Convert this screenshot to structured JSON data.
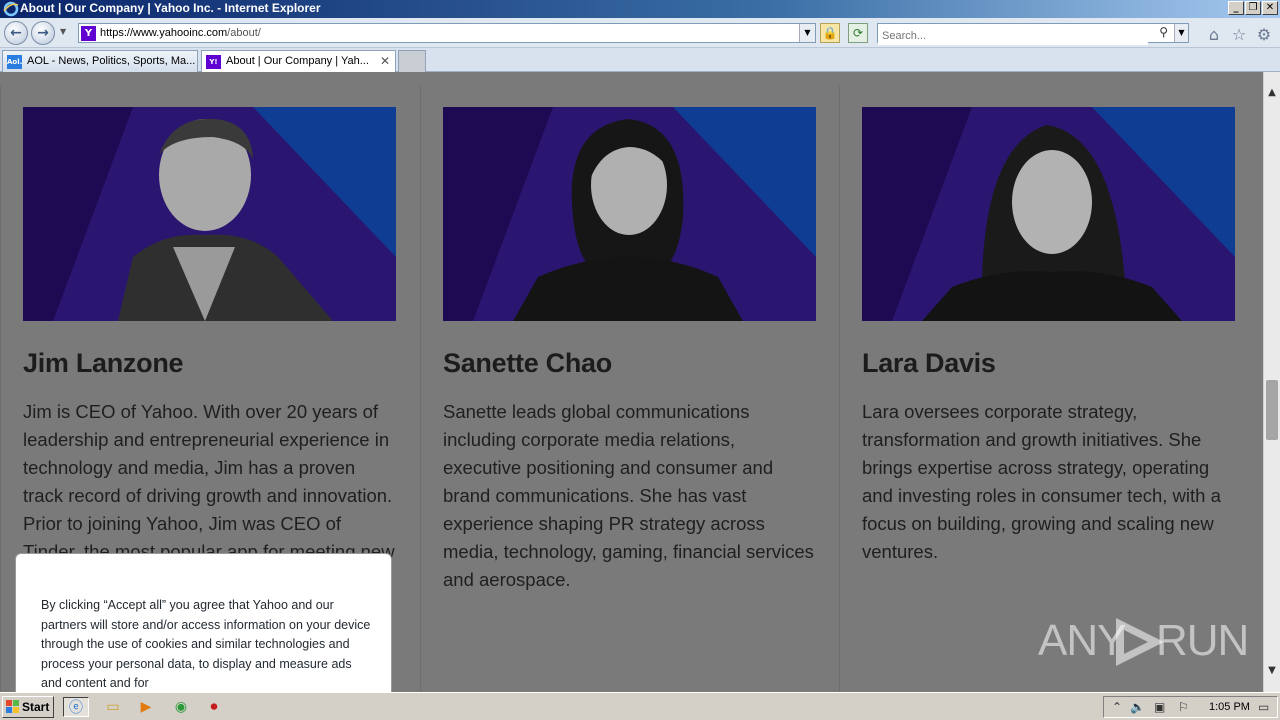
{
  "window": {
    "title": "About | Our Company | Yahoo Inc. - Internet Explorer",
    "controls": [
      "minimize",
      "restore",
      "close"
    ]
  },
  "navbar": {
    "url_host": "https://www.yahooinc.com",
    "url_path": "/about/",
    "search_placeholder": "Search...",
    "icons": [
      "back-icon",
      "forward-icon",
      "lock-icon",
      "refresh-icon",
      "search-icon",
      "home-icon",
      "favorites-icon",
      "gear-icon"
    ]
  },
  "tabs": [
    {
      "label": "AOL - News, Politics, Sports, Ma...",
      "icon": "aol-icon",
      "active": false,
      "icon_text": "Aol."
    },
    {
      "label": "About | Our Company | Yah...",
      "icon": "yahoo-icon",
      "active": true,
      "icon_text": "Y!"
    }
  ],
  "people": [
    {
      "name": "Jim Lanzone",
      "bio": "Jim is CEO of Yahoo. With over 20 years of leadership and entrepreneurial experience in technology and media, Jim has a proven track record of driving growth and innovation. Prior to joining Yahoo, Jim was CEO of Tinder, the most popular app for meeting new people, as"
    },
    {
      "name": "Sanette Chao",
      "bio": "Sanette leads global communications including corporate media relations, executive positioning and consumer and brand communications. She has vast experience shaping PR strategy across media, technology, gaming, financial services and aerospace."
    },
    {
      "name": "Lara Davis",
      "bio": "Lara oversees corporate strategy, transformation and growth initiatives.  She brings expertise across strategy, operating and investing roles in consumer tech, with a focus on building, growing and scaling new ventures."
    }
  ],
  "cookie_notice": {
    "text": "By clicking “Accept all” you agree that Yahoo and our partners will store and/or access information on your device through the use of cookies and similar technologies and process your personal data, to display and measure ads and content and for"
  },
  "watermark": {
    "text_left": "ANY",
    "text_right": "RUN"
  },
  "taskbar": {
    "start_label": "Start",
    "clock": "1:05 PM"
  },
  "colors": {
    "photo_bg_dark": "#1d0a52",
    "photo_bg_mid": "#2a1670",
    "photo_bg_blue": "#0f3d93",
    "overlay_gray": "#7a7a7a"
  }
}
